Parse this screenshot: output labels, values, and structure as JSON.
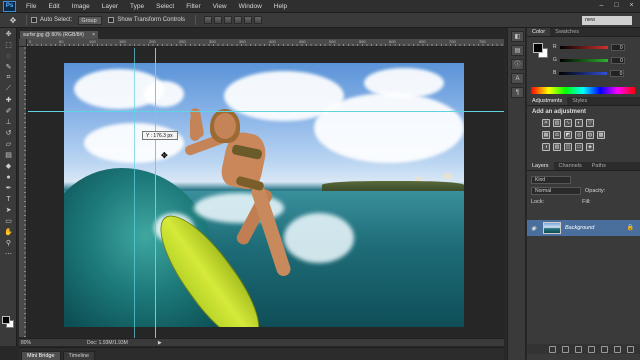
{
  "menu": {
    "logo": "Ps",
    "items": [
      "File",
      "Edit",
      "Image",
      "Layer",
      "Type",
      "Select",
      "Filter",
      "View",
      "Window",
      "Help"
    ]
  },
  "window_controls": [
    "–",
    "□",
    "×"
  ],
  "options_bar": {
    "auto_select_label": "Auto Select:",
    "auto_select_value": "Group",
    "show_transform_label": "Show Transform Controls",
    "workspace": "new"
  },
  "document": {
    "tab_title": "surfer.jpg @ 80% (RGB/8#)",
    "tab_close": "×",
    "ruler_numbers": [
      "0",
      "50",
      "100",
      "150",
      "200",
      "250",
      "300",
      "350",
      "400",
      "450",
      "500",
      "550",
      "600",
      "650",
      "700",
      "750"
    ]
  },
  "canvas": {
    "tooltip_text": "Y : 176.3 px"
  },
  "status": {
    "zoom": "80%",
    "doc_info": "Doc: 1.93M/1.93M",
    "arrow": "▶"
  },
  "bottom_tabs": [
    "Mini Bridge",
    "Timeline"
  ],
  "panels": {
    "color_tabs": [
      "Color",
      "Swatches"
    ],
    "sliders": [
      {
        "label": "R",
        "value": "0",
        "color": "#d43030"
      },
      {
        "label": "G",
        "value": "0",
        "color": "#30b030"
      },
      {
        "label": "B",
        "value": "0",
        "color": "#3050d8"
      }
    ],
    "adj_tabs": [
      "Adjustments",
      "Styles"
    ],
    "adj_title": "Add an adjustment",
    "layer_tabs": [
      "Layers",
      "Channels",
      "Paths"
    ],
    "kind_label": "Kind",
    "blend_mode": "Normal",
    "opacity_label": "Opacity:",
    "lock_label": "Lock:",
    "fill_label": "Fill:",
    "layer_name": "Background"
  },
  "colors": {
    "accent": "#4b6f9c",
    "guide": "#5fd3e0"
  }
}
